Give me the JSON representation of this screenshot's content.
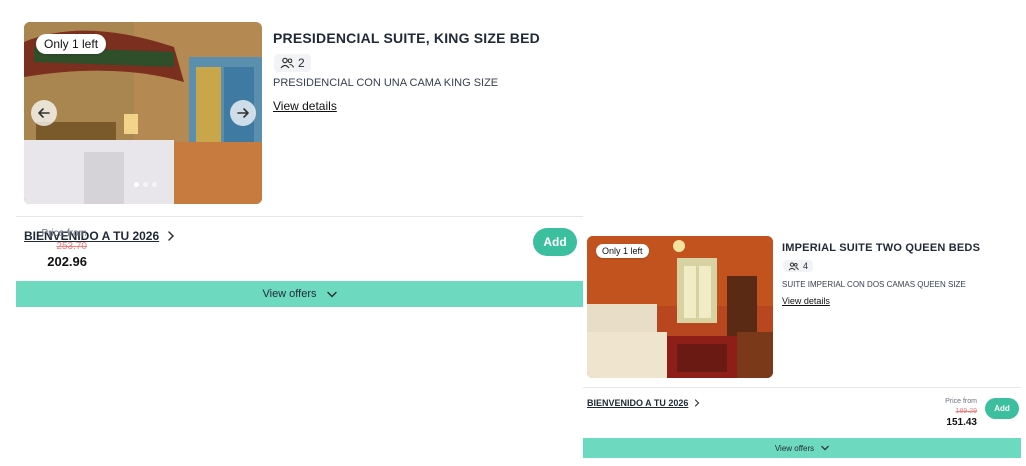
{
  "colors": {
    "accent": "#3cbf9e",
    "offers_bar": "#6dd9bf",
    "old_price": "#f08080"
  },
  "rooms": [
    {
      "badge": "Only 1 left",
      "title": "PRESIDENCIAL SUITE, KING SIZE BED",
      "occupancy": "2",
      "occupancy_icon": "guests-icon",
      "description": "PRESIDENCIAL CON UNA CAMA KING SIZE",
      "view_details": "View details",
      "rate": {
        "name": "BIENVENIDO A TU 2026",
        "price_from_label": "Price from",
        "old_price": "253.70",
        "price": "202.96",
        "add_label": "Add"
      },
      "view_offers": "View offers"
    },
    {
      "badge": "Only 1 left",
      "title": "IMPERIAL SUITE TWO QUEEN BEDS",
      "occupancy": "4",
      "occupancy_icon": "guests-icon",
      "description": "SUITE IMPERIAL CON DOS CAMAS QUEEN SIZE",
      "view_details": "View details",
      "rate": {
        "name": "BIENVENIDO A TU 2026",
        "price_from_label": "Price from",
        "old_price": "189.29",
        "price": "151.43",
        "add_label": "Add"
      },
      "view_offers": "View offers"
    }
  ]
}
